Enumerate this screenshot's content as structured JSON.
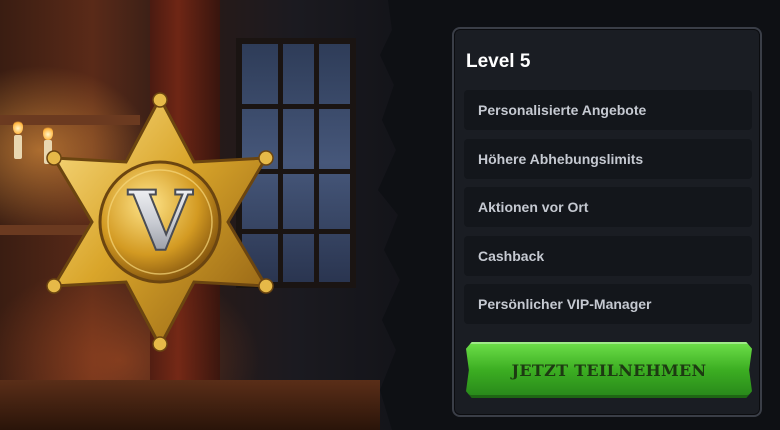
{
  "vip": {
    "badge_letter": "V",
    "level_title": "Level 5",
    "perks": [
      {
        "label": "Personalisierte Angebote"
      },
      {
        "label": "Höhere Abhebungslimits"
      },
      {
        "label": "Aktionen vor Ort"
      },
      {
        "label": "Cashback"
      },
      {
        "label": "Persönlicher VIP-Manager"
      }
    ],
    "cta_label": "JETZT TEILNEHMEN"
  },
  "colors": {
    "panel_bg": "#1a1d23",
    "perk_bg": "#13161b",
    "cta_green": "#3cae22",
    "badge_gold": "#d9a52a"
  },
  "icons": [
    "sheriff-star-badge-icon"
  ]
}
